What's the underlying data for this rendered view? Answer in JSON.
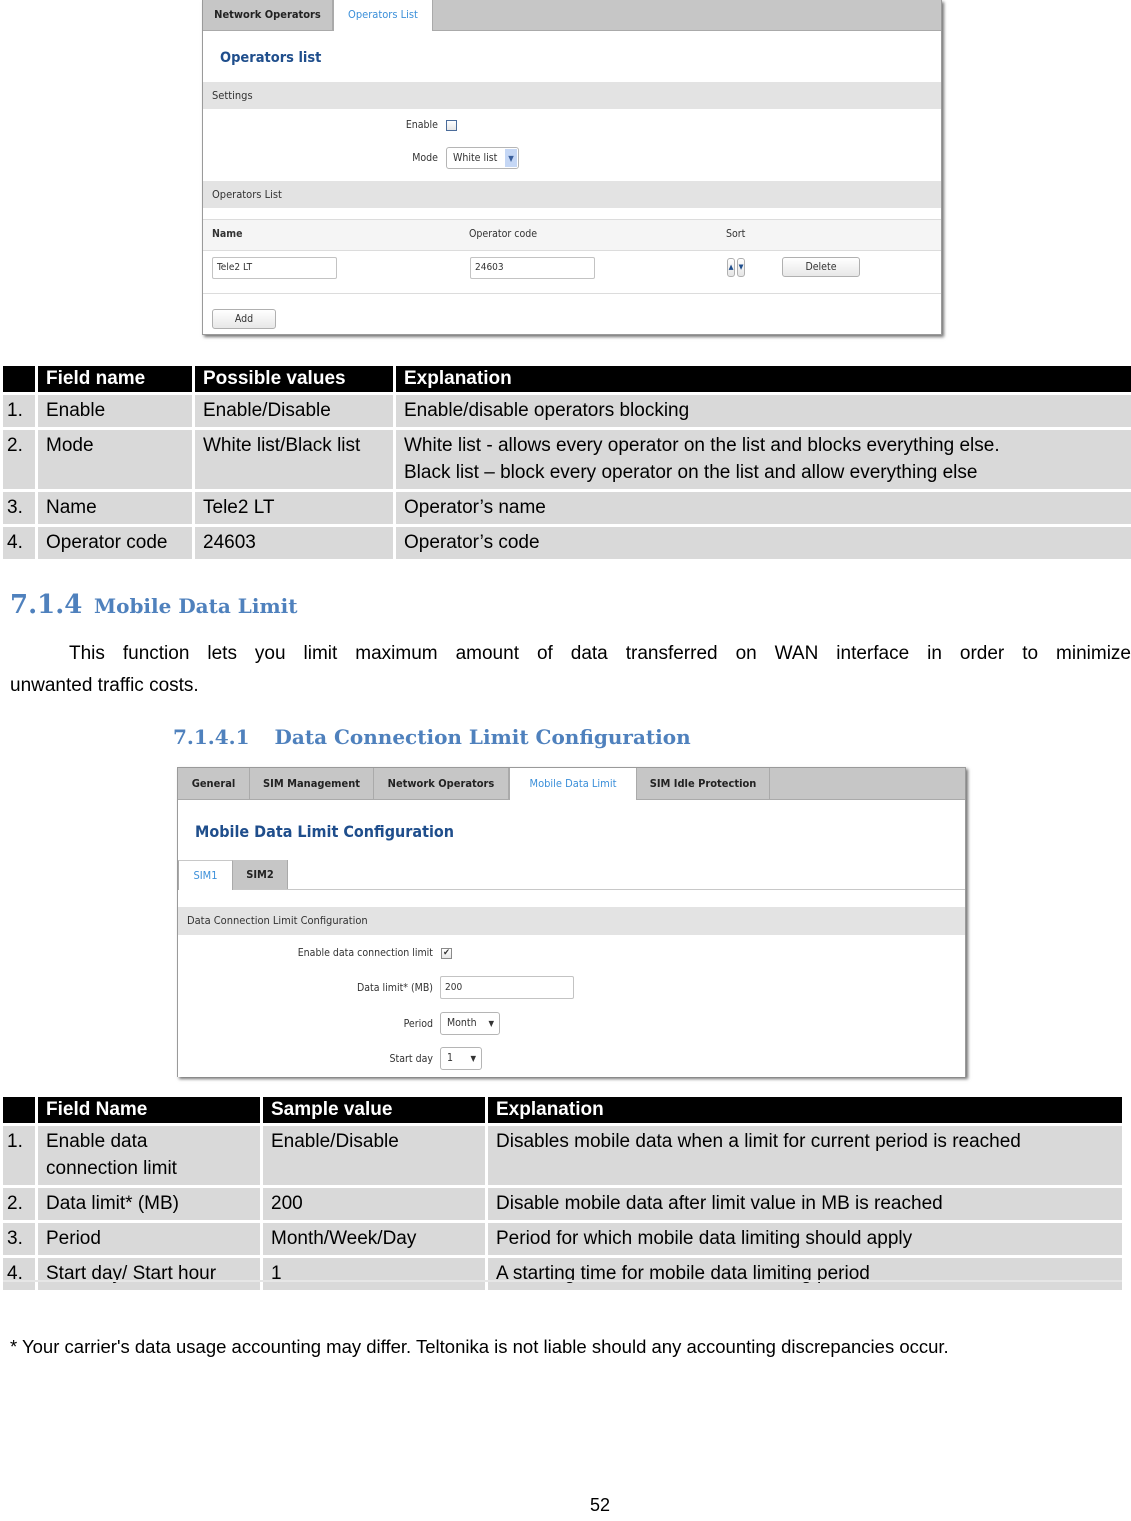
{
  "screenshot1": {
    "tabs": [
      {
        "label": "Network Operators",
        "active": false
      },
      {
        "label": "Operators List",
        "active": true
      }
    ],
    "title": "Operators list",
    "settings_header": "Settings",
    "enable_label": "Enable",
    "enable_checked": false,
    "mode_label": "Mode",
    "mode_value": "White list",
    "operators_header": "Operators List",
    "columns": {
      "name": "Name",
      "code": "Operator code",
      "sort": "Sort"
    },
    "row": {
      "name": "Tele2 LT",
      "code": "24603"
    },
    "delete_label": "Delete",
    "add_label": "Add"
  },
  "table1": {
    "headers": [
      "",
      "Field name",
      "Possible values",
      "Explanation"
    ],
    "rows": [
      {
        "num": "1.",
        "field": "Enable",
        "values": "Enable/Disable",
        "explanation": "Enable/disable operators blocking"
      },
      {
        "num": "2.",
        "field": "Mode",
        "values": "White list/Black list",
        "explanation": "White list - allows every operator on the list and blocks everything else.",
        "explanation2": "Black list – block every operator on the list and allow everything else"
      },
      {
        "num": "3.",
        "field": "Name",
        "values": "Tele2 LT",
        "explanation": "Operator’s name"
      },
      {
        "num": "4.",
        "field": "Operator code",
        "values": "24603",
        "explanation": "Operator’s code"
      }
    ]
  },
  "section": {
    "number": "7.1.4",
    "title": "Mobile Data Limit",
    "paragraph_line1": "This function lets you limit maximum amount of data transferred on WAN interface in order to minimize",
    "paragraph_line2": "unwanted traffic costs.",
    "subsection_number": "7.1.4.1",
    "subsection_title": "Data Connection Limit Configuration"
  },
  "screenshot2": {
    "tabs": [
      {
        "label": "General",
        "active": false
      },
      {
        "label": "SIM Management",
        "active": false
      },
      {
        "label": "Network Operators",
        "active": false
      },
      {
        "label": "Mobile Data Limit",
        "active": true
      },
      {
        "label": "SIM Idle Protection",
        "active": false
      }
    ],
    "title": "Mobile Data Limit Configuration",
    "sim_tabs": [
      {
        "label": "SIM1",
        "active": true
      },
      {
        "label": "SIM2",
        "active": false
      }
    ],
    "section_header": "Data Connection Limit Configuration",
    "enable_label": "Enable data connection limit",
    "enable_checked": true,
    "data_limit_label": "Data limit* (MB)",
    "data_limit_value": "200",
    "period_label": "Period",
    "period_value": "Month",
    "start_day_label": "Start day",
    "start_day_value": "1"
  },
  "table2": {
    "headers": [
      "",
      "Field Name",
      "Sample value",
      "Explanation"
    ],
    "rows": [
      {
        "num": "1.",
        "field": "Enable data",
        "field2": "connection limit",
        "values": "Enable/Disable",
        "explanation": "Disables mobile data when a limit for current period is reached"
      },
      {
        "num": "2.",
        "field": "Data limit* (MB)",
        "values": "200",
        "explanation": "Disable mobile data after limit value in MB is reached"
      },
      {
        "num": "3.",
        "field": "Period",
        "values": "Month/Week/Day",
        "explanation": "Period for which mobile data limiting should apply"
      },
      {
        "num": "4.",
        "field": "Start day/ Start hour",
        "values": "1",
        "explanation": "A starting time for mobile data limiting period"
      }
    ]
  },
  "footnote": "* Your carrier's data usage accounting may differ. Teltonika is not liable should any accounting discrepancies occur.",
  "page_number": "52"
}
